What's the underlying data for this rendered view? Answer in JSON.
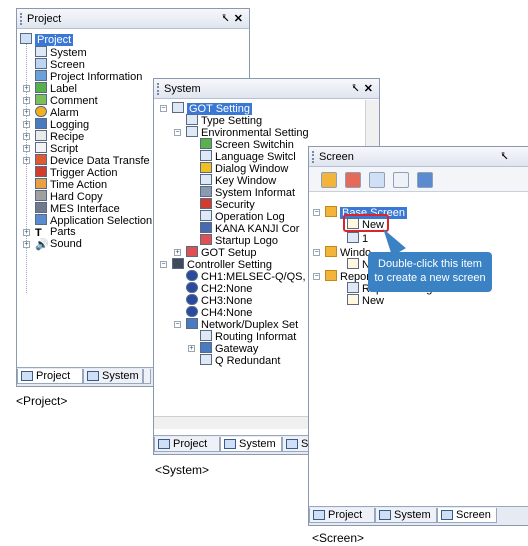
{
  "project_panel": {
    "title": "Project",
    "pin": "&#x1F4CC;",
    "close": "✕",
    "items": [
      {
        "label": "Project",
        "level": 0
      },
      {
        "label": "System",
        "level": 1
      },
      {
        "label": "Screen",
        "level": 1
      },
      {
        "label": "Project Information",
        "level": 1
      },
      {
        "label": "Label",
        "level": 1
      },
      {
        "label": "Comment",
        "level": 1
      },
      {
        "label": "Alarm",
        "level": 1
      },
      {
        "label": "Logging",
        "level": 1
      },
      {
        "label": "Recipe",
        "level": 1
      },
      {
        "label": "Script",
        "level": 1
      },
      {
        "label": "Device Data Transfe",
        "level": 1
      },
      {
        "label": "Trigger Action",
        "level": 1
      },
      {
        "label": "Time Action",
        "level": 1
      },
      {
        "label": "Hard Copy",
        "level": 1
      },
      {
        "label": "MES Interface",
        "level": 1
      },
      {
        "label": "Application Selection",
        "level": 1
      },
      {
        "label": "Parts",
        "level": 1
      },
      {
        "label": "Sound",
        "level": 1
      }
    ],
    "tabs": [
      "Project",
      "System",
      ""
    ],
    "caption": "<Project>"
  },
  "system_panel": {
    "title": "System",
    "items": [
      {
        "label": "GOT Setting"
      },
      {
        "label": "Type Setting"
      },
      {
        "label": "Environmental Setting"
      },
      {
        "label": "Screen Switchin"
      },
      {
        "label": "Language Switcl"
      },
      {
        "label": "Dialog Window"
      },
      {
        "label": "Key Window"
      },
      {
        "label": "System Informat"
      },
      {
        "label": "Security"
      },
      {
        "label": "Operation Log"
      },
      {
        "label": "KANA KANJI Cor"
      },
      {
        "label": "Startup Logo"
      },
      {
        "label": "GOT Setup"
      },
      {
        "label": "Controller Setting"
      },
      {
        "label": "CH1:MELSEC-Q/QS,"
      },
      {
        "label": "CH2:None"
      },
      {
        "label": "CH3:None"
      },
      {
        "label": "CH4:None"
      },
      {
        "label": "Network/Duplex Set"
      },
      {
        "label": "Routing Informat"
      },
      {
        "label": "Gateway"
      },
      {
        "label": "Q Redundant"
      }
    ],
    "tabs": [
      "Project",
      "System",
      "Scr"
    ],
    "caption": "<System>"
  },
  "screen_panel": {
    "title": "Screen",
    "items": [
      {
        "label": "Base Screen"
      },
      {
        "label": "New"
      },
      {
        "label": "1"
      },
      {
        "label": "Windo"
      },
      {
        "label": "Ne"
      },
      {
        "label": "Repor"
      },
      {
        "label": "Report Setting"
      },
      {
        "label": "New"
      }
    ],
    "tabs": [
      "Project",
      "System",
      "Screen"
    ],
    "caption": "<Screen>"
  },
  "callout": {
    "line1": "Double-click this item",
    "line2": "to create a new screen"
  },
  "colors": {
    "selection": "#3a78d4",
    "callout": "#3b82c4",
    "highlight": "#d9262c"
  }
}
